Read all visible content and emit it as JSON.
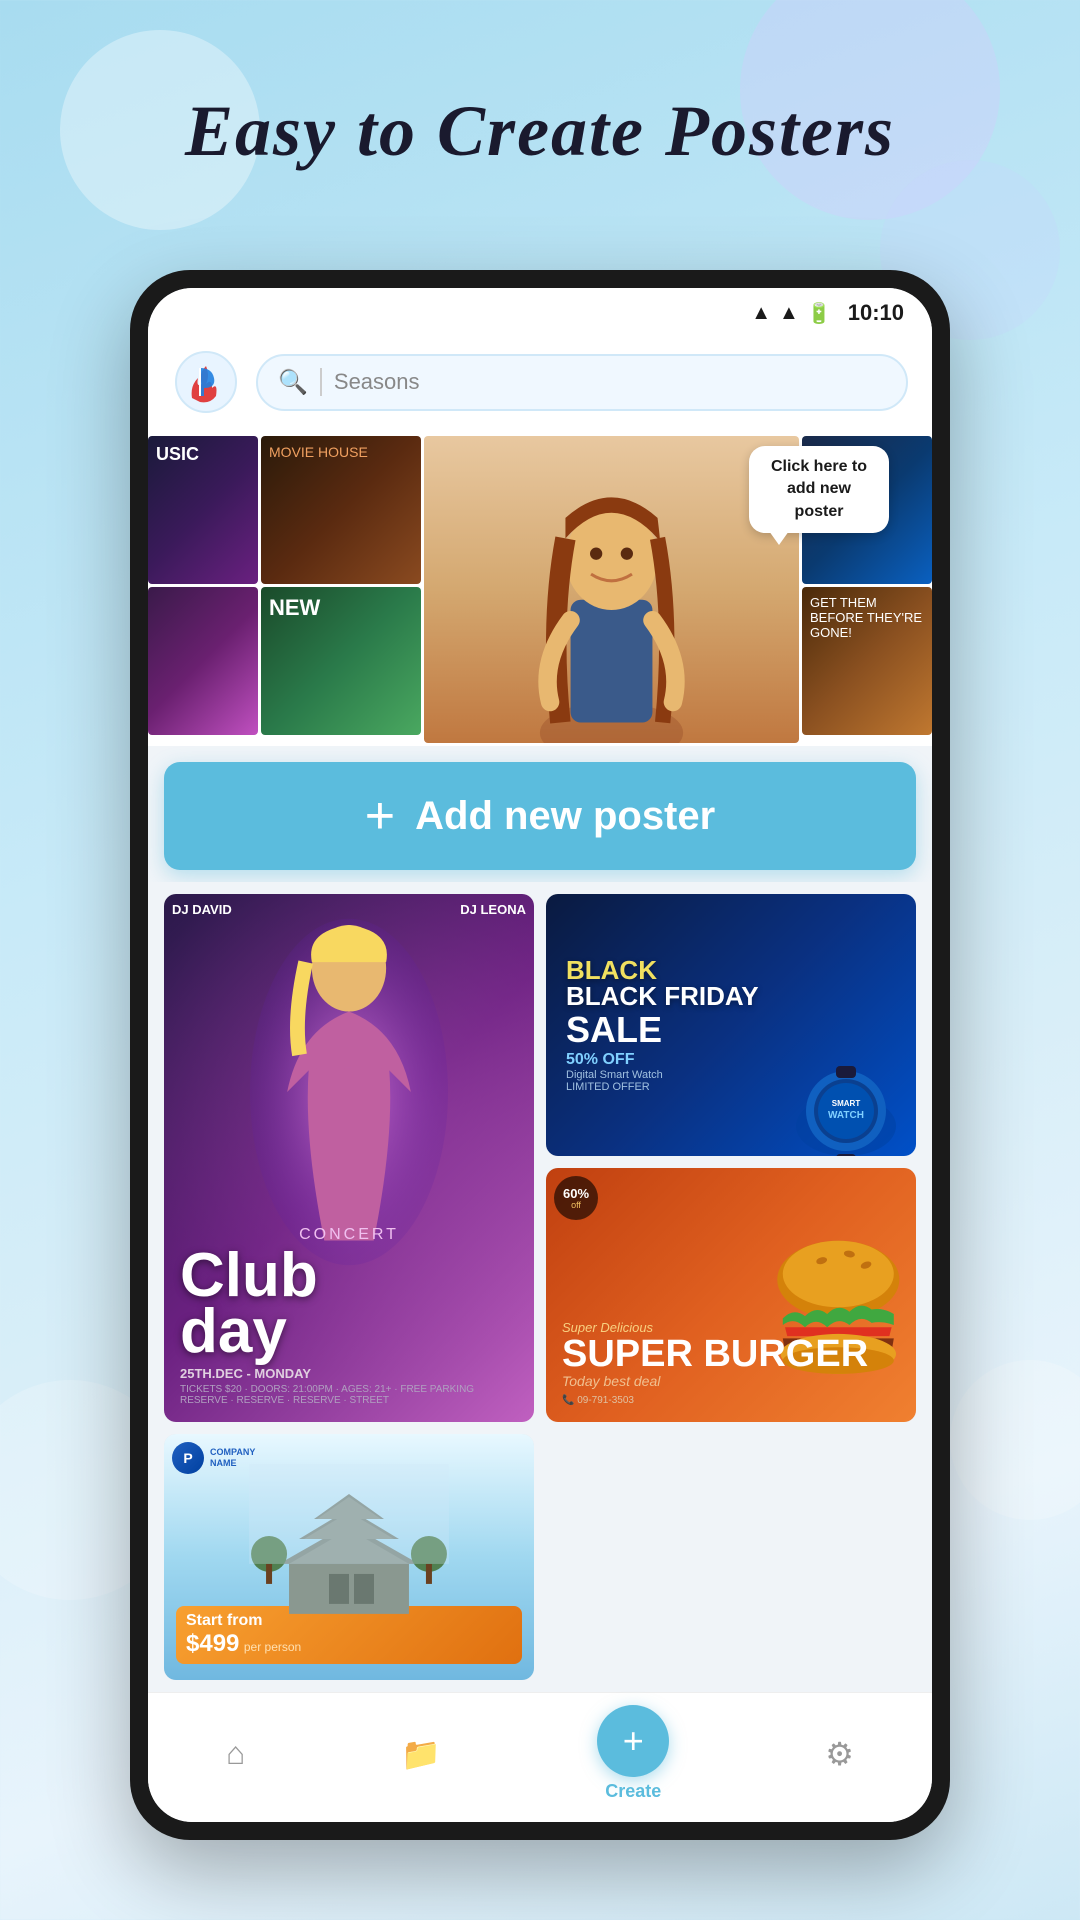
{
  "app": {
    "title": "Easy to Create Posters",
    "status_time": "10:10"
  },
  "header": {
    "search_placeholder": "Seasons"
  },
  "add_button": {
    "label": "Add new poster",
    "plus": "+"
  },
  "speech_bubble": {
    "text": "Click here to add new poster"
  },
  "nav": {
    "home_label": "Home",
    "folder_label": "Folder",
    "create_label": "Create",
    "settings_label": "Settings",
    "plus": "+"
  },
  "posters": {
    "club_title": "Club",
    "club_subtitle": "day",
    "club_date": "25TH.DEC - MONDAY",
    "bf_title": "BLACK FRIDAY",
    "bf_sale": "SALE",
    "bf_discount": "50% OFF",
    "burger_title": "SUPER BURGER",
    "burger_sub": "Today best deal",
    "travel_price": "Start from $499",
    "travel_per": "per person"
  }
}
